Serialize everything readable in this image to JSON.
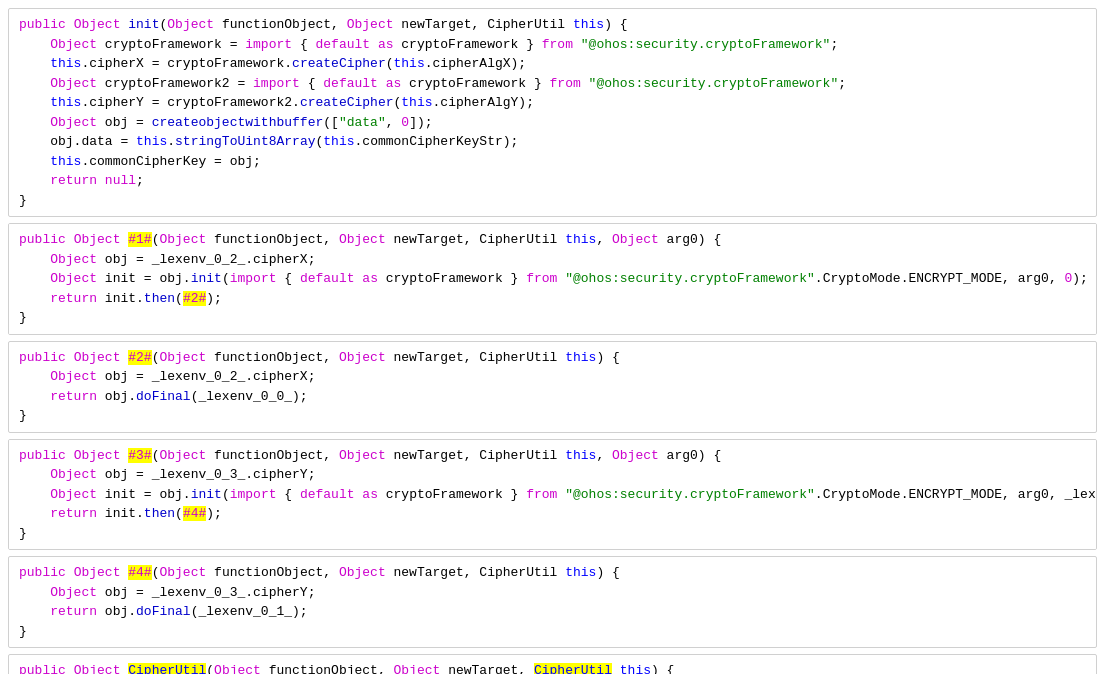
{
  "blocks": [
    {
      "id": "block1",
      "lines": [
        {
          "id": "b1l1"
        },
        {
          "id": "b1l2"
        },
        {
          "id": "b1l3"
        },
        {
          "id": "b1l4"
        },
        {
          "id": "b1l5"
        },
        {
          "id": "b1l6"
        },
        {
          "id": "b1l7"
        },
        {
          "id": "b1l8"
        },
        {
          "id": "b1l9"
        }
      ]
    },
    {
      "id": "block2"
    },
    {
      "id": "block3"
    },
    {
      "id": "block4"
    },
    {
      "id": "block5"
    },
    {
      "id": "block6"
    }
  ]
}
